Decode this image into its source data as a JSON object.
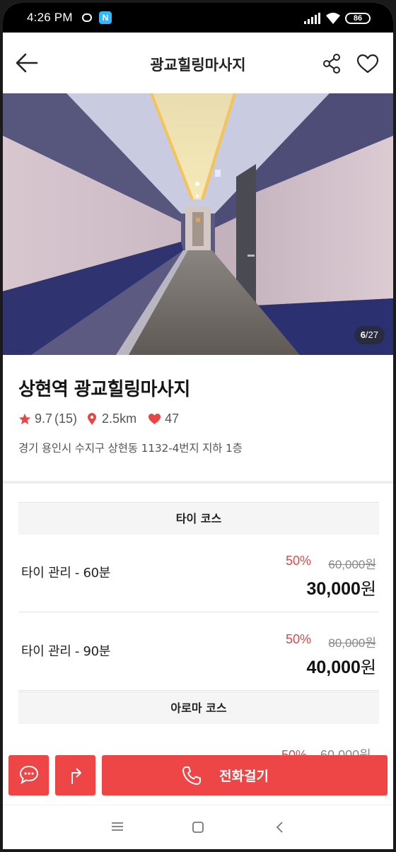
{
  "status_bar": {
    "time": "4:26 PM",
    "battery": "86"
  },
  "header": {
    "title": "광교힐링마사지"
  },
  "gallery": {
    "current": "6",
    "total": "/27"
  },
  "shop": {
    "name": "상현역 광교힐링마사지",
    "rating": "9.7",
    "review_count": "(15)",
    "distance": "2.5km",
    "likes": "47",
    "address": "경기 용인시 수지구 상현동 1132-4번지 지하 1층"
  },
  "courses": [
    {
      "section": "타이 코스",
      "items": [
        {
          "name": "타이 관리 - 60분",
          "discount": "50%",
          "original_price": "60,000원",
          "price": "30,000",
          "currency": "원"
        },
        {
          "name": "타이 관리 - 90분",
          "discount": "50%",
          "original_price": "80,000원",
          "price": "40,000",
          "currency": "원"
        }
      ]
    },
    {
      "section": "아로마 코스",
      "peek_discount": "50%",
      "peek_original": "60,000원"
    }
  ],
  "actions": {
    "call_label": "전화걸기"
  },
  "colors": {
    "accent": "#ee4646",
    "discount": "#d64c4c"
  }
}
